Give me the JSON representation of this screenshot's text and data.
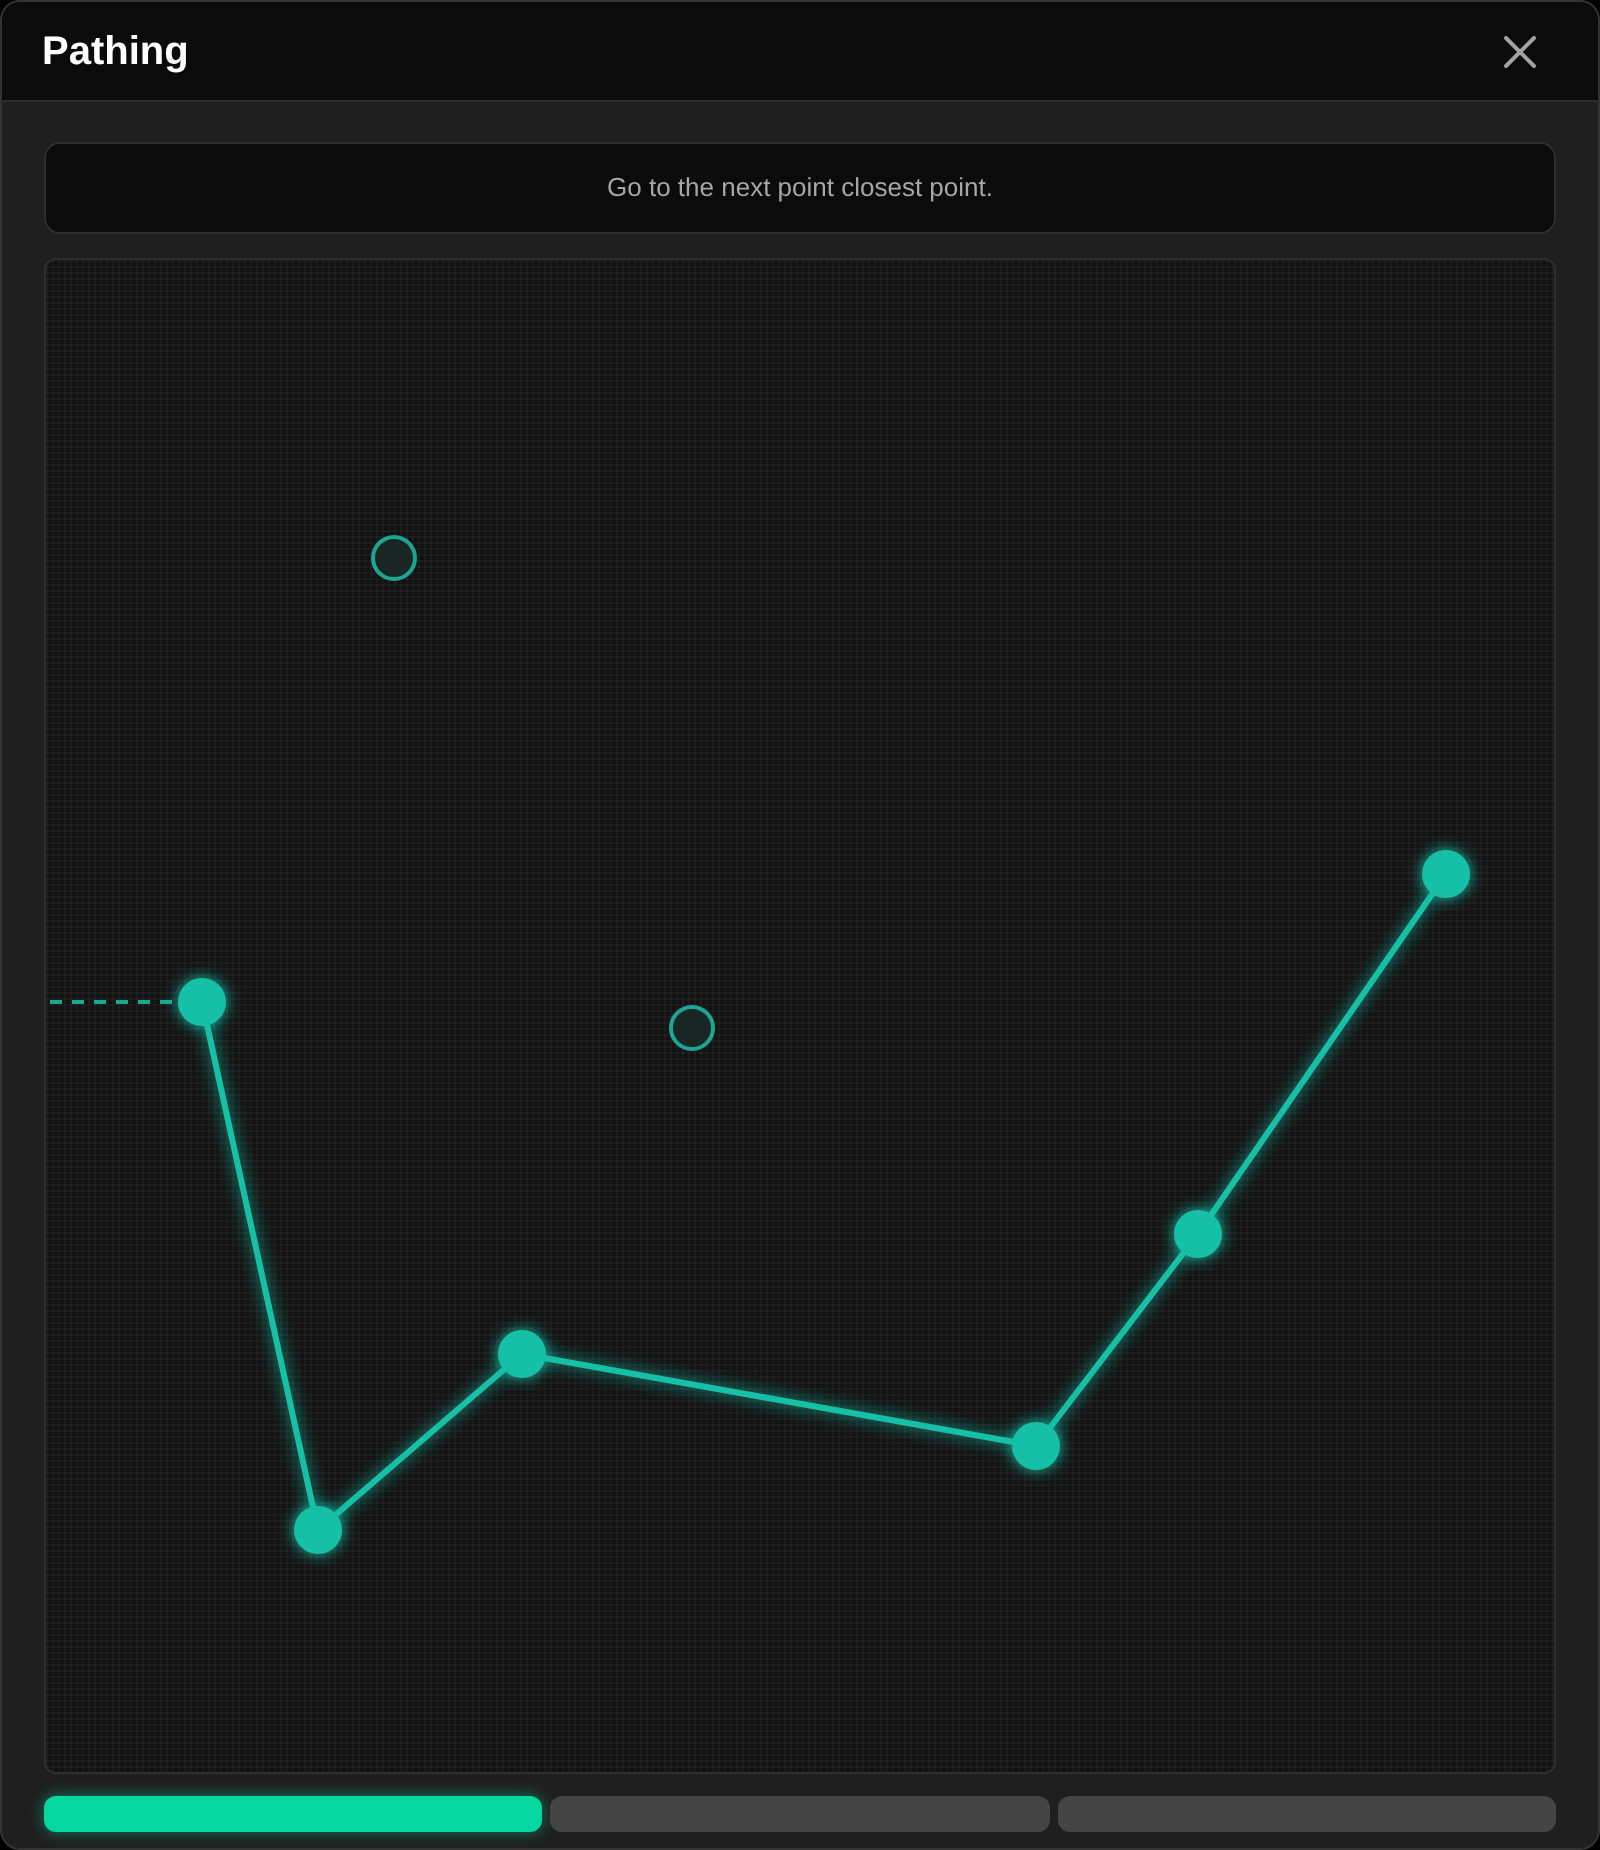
{
  "window": {
    "title": "Pathing"
  },
  "instruction": "Go to the next point closest point.",
  "points": [
    {
      "visited": true
    },
    {
      "visited": true
    },
    {
      "visited": true
    },
    {
      "visited": true
    },
    {
      "visited": true
    },
    {
      "visited": true
    },
    {
      "visited": false
    },
    {
      "visited": false
    }
  ],
  "stages": [
    {
      "done": true
    },
    {
      "done": false
    },
    {
      "done": false
    }
  ]
}
